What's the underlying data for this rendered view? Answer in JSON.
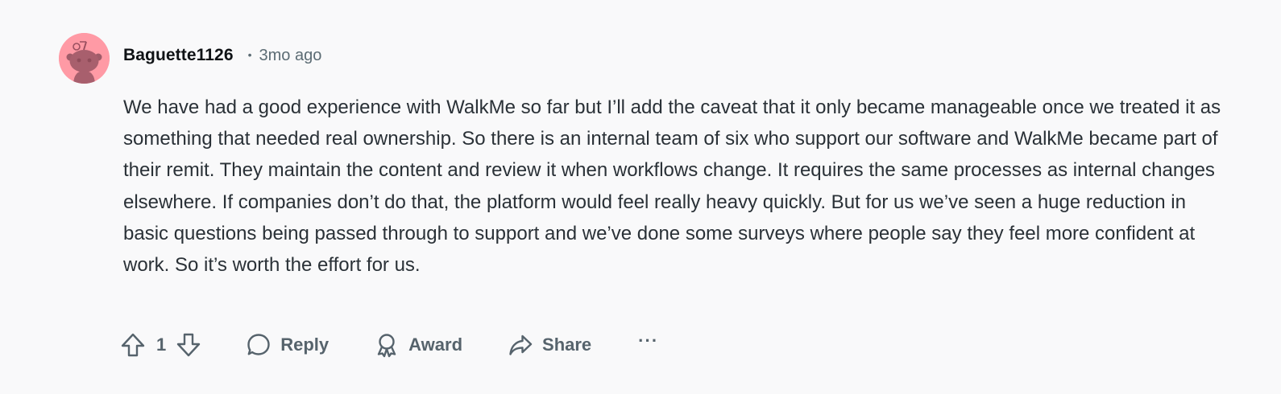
{
  "comment": {
    "author": "Baguette1126",
    "separator": "•",
    "timestamp": "3mo ago",
    "avatar_bg": "#ff9aa5",
    "body": "We have had a good experience with WalkMe so far but I’ll add the caveat that it only became manageable once we treated it as something that needed real ownership. So there is an internal team of six who support our software and WalkMe became part of their remit. They maintain the content and review it when workflows change. It requires the same processes as internal changes elsewhere. If companies don’t do that, the platform would feel really heavy quickly. But for us we’ve seen a huge reduction in basic questions being passed through to support and we’ve done some surveys where people say they feel more confident at work. So it’s worth the effort for us."
  },
  "actions": {
    "upvote_icon": "arrow-up-icon",
    "score": "1",
    "downvote_icon": "arrow-down-icon",
    "reply_label": "Reply",
    "reply_icon": "speech-bubble-icon",
    "award_label": "Award",
    "award_icon": "award-ribbon-icon",
    "share_label": "Share",
    "share_icon": "share-arrow-icon",
    "more_label": "···"
  },
  "colors": {
    "background": "#f9f9fa",
    "text": "#2a3137",
    "muted": "#56636c"
  }
}
